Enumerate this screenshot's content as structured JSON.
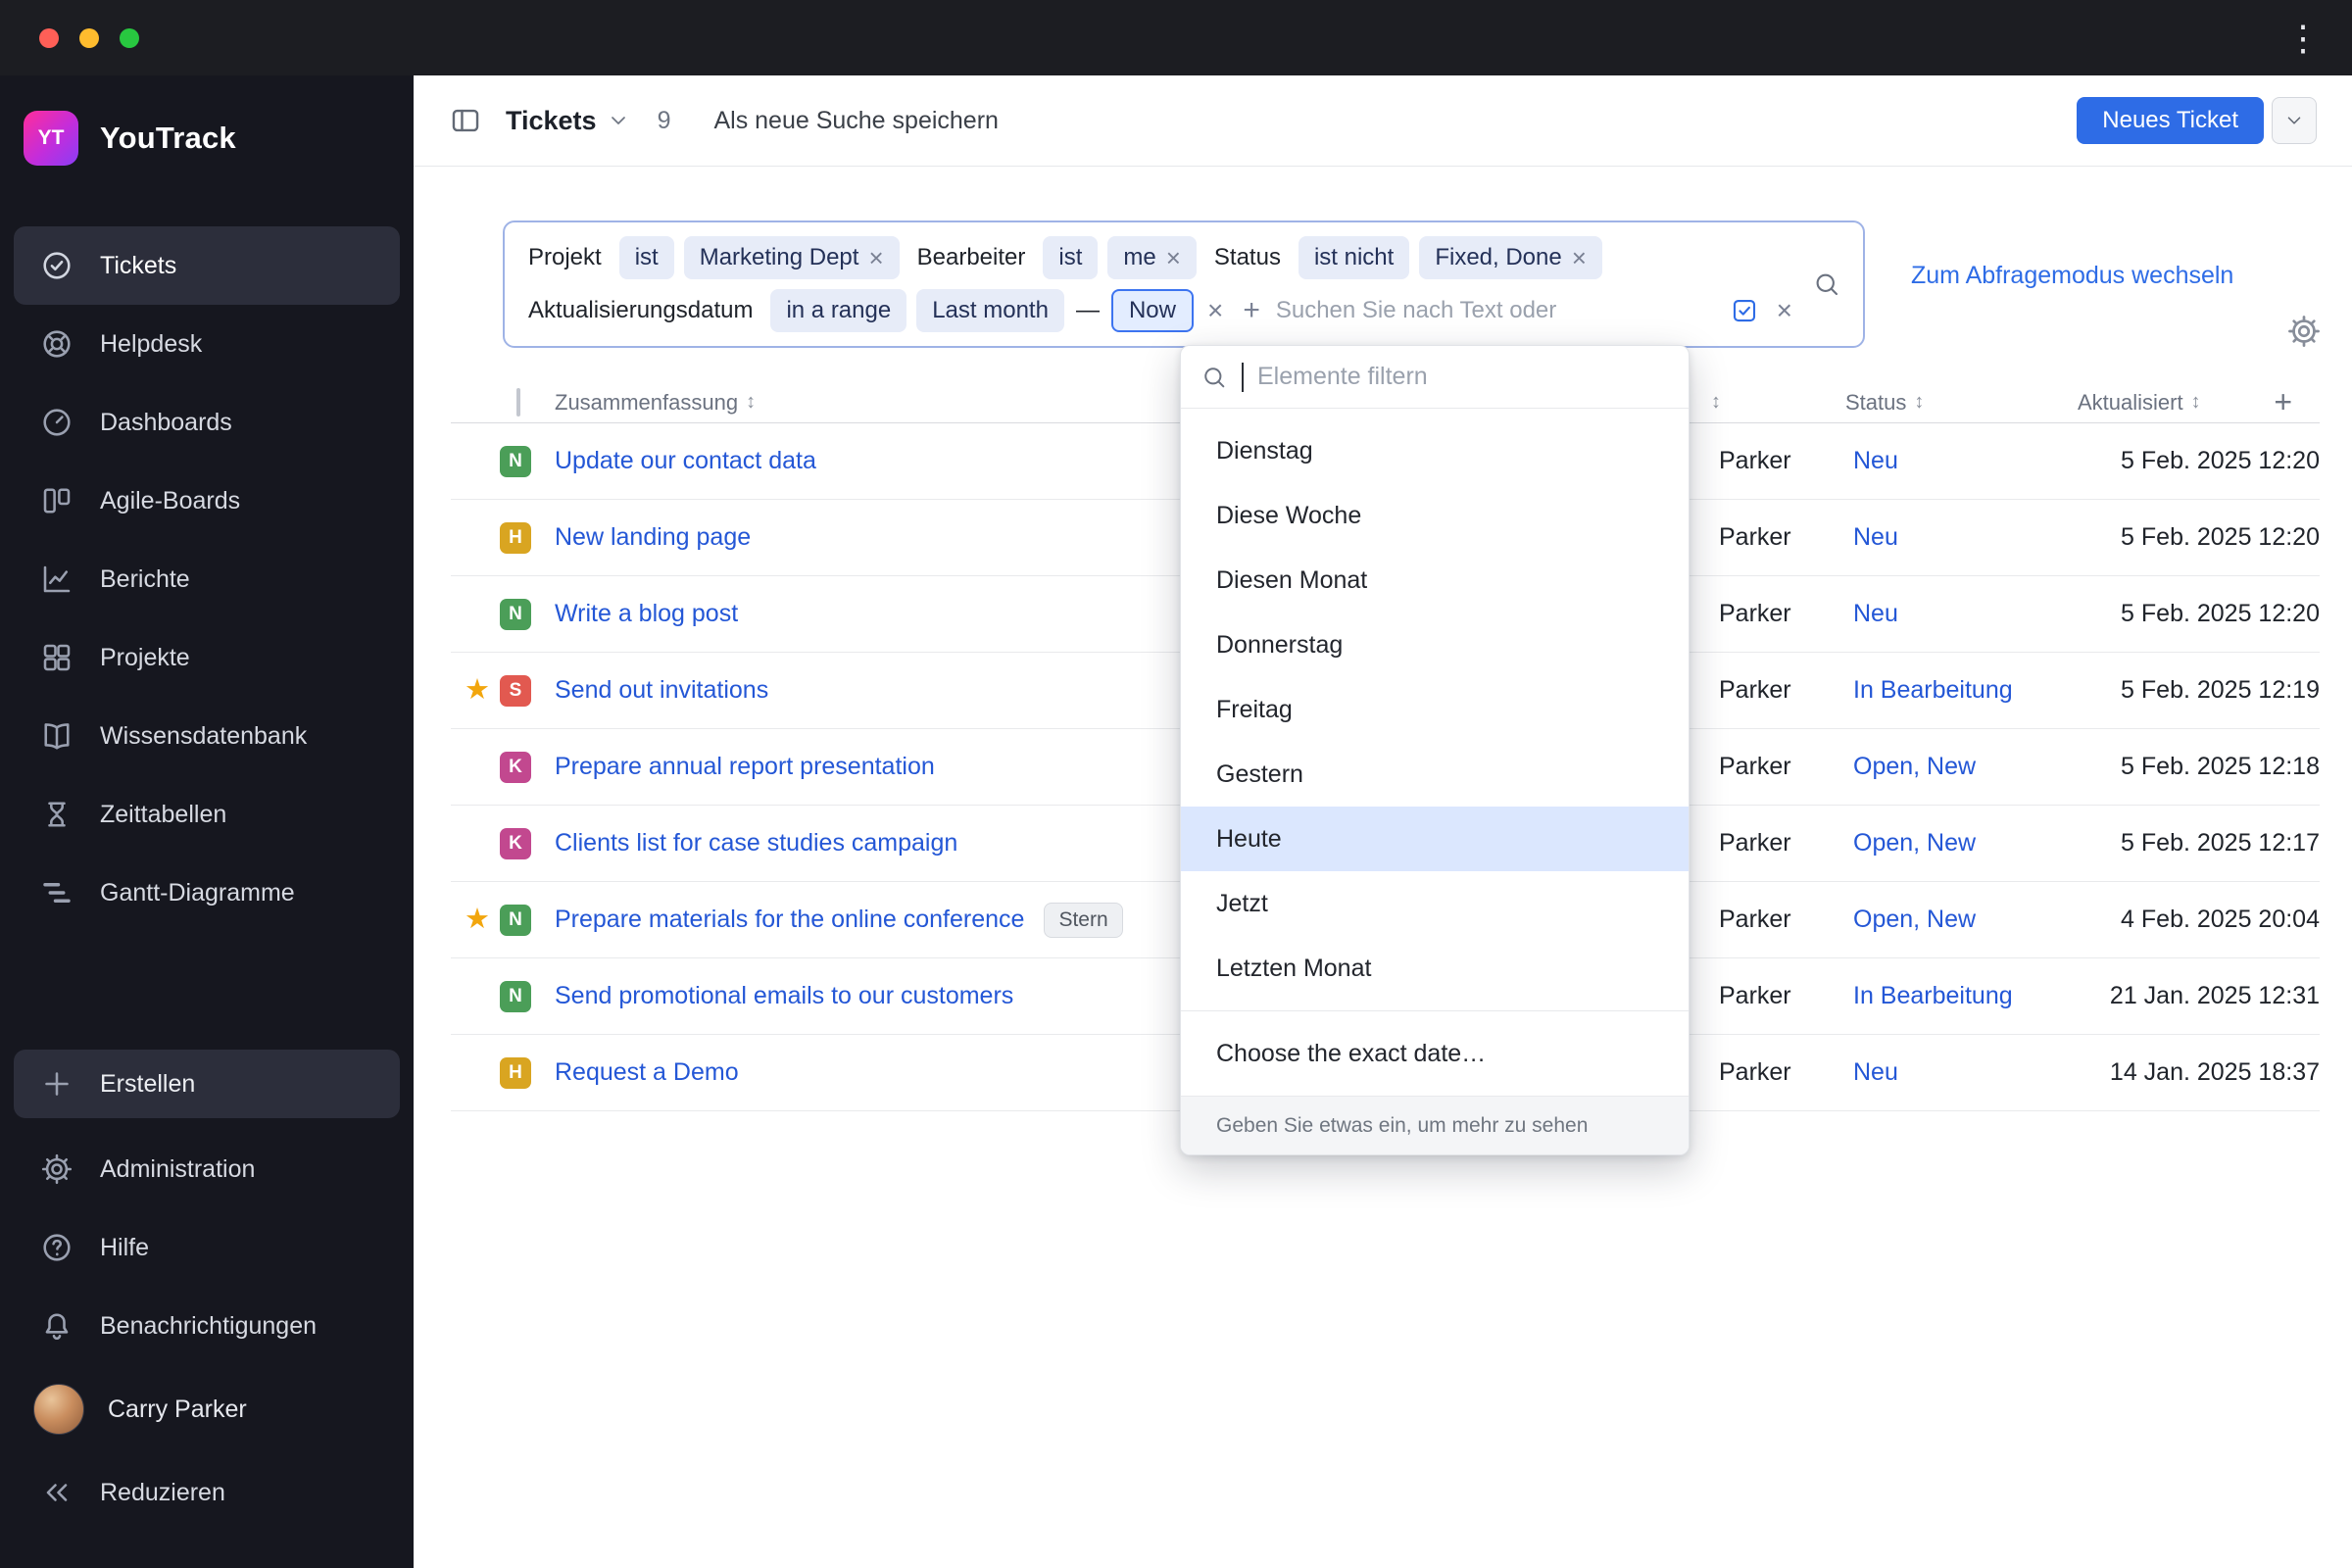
{
  "colors": {
    "accent_blue": "#2e6ce6",
    "link_blue": "#2457d6",
    "badge_green": "#4b9e58",
    "badge_amber": "#d9a521",
    "badge_red": "#e25950",
    "badge_magenta": "#c2488f",
    "star": "#f2a60d",
    "selected_item_bg": "#dbe7fe"
  },
  "sidebar": {
    "logo_badge": "YT",
    "logo_text": "YouTrack",
    "items": [
      {
        "label": "Tickets"
      },
      {
        "label": "Helpdesk"
      },
      {
        "label": "Dashboards"
      },
      {
        "label": "Agile-Boards"
      },
      {
        "label": "Berichte"
      },
      {
        "label": "Projekte"
      },
      {
        "label": "Wissensdatenbank"
      },
      {
        "label": "Zeittabellen"
      },
      {
        "label": "Gantt-Diagramme"
      }
    ],
    "create_label": "Erstellen",
    "admin_items": [
      "Administration",
      "Hilfe",
      "Benachrichtigungen"
    ],
    "user_name": "Carry Parker",
    "collapse_label": "Reduzieren"
  },
  "header": {
    "title": "Tickets",
    "count": "9",
    "save_search": "Als neue Suche speichern",
    "new_ticket": "Neues Ticket"
  },
  "filter": {
    "groups": [
      {
        "attr": "Projekt",
        "op": "ist",
        "value": "Marketing Dept"
      },
      {
        "attr": "Bearbeiter",
        "op": "ist",
        "value": "me"
      },
      {
        "attr": "Status",
        "op": "ist nicht",
        "value": "Fixed, Done"
      }
    ],
    "range": {
      "attr": "Aktualisierungsdatum",
      "op": "in a range",
      "from": "Last month",
      "dash": "—",
      "to": "Now"
    },
    "input_placeholder": "Suchen Sie nach Text oder",
    "mode_switch": "Zum Abfragemodus wechseln"
  },
  "table": {
    "headers": {
      "summary": "Zusammenfassung",
      "status": "Status",
      "updated": "Aktualisiert"
    },
    "rows": [
      {
        "badge": "N",
        "badge_color": "#4b9e58",
        "summary": "Update our contact data",
        "assignee": "Parker",
        "status": "Neu",
        "updated": "5 Feb. 2025 12:20"
      },
      {
        "badge": "H",
        "badge_color": "#d9a521",
        "summary": "New landing page",
        "assignee": "Parker",
        "status": "Neu",
        "updated": "5 Feb. 2025 12:20"
      },
      {
        "badge": "N",
        "badge_color": "#4b9e58",
        "summary": "Write a blog post",
        "assignee": "Parker",
        "status": "Neu",
        "updated": "5 Feb. 2025 12:20"
      },
      {
        "badge": "S",
        "badge_color": "#e25950",
        "summary": "Send out invitations",
        "assignee": "Parker",
        "status": "In Bearbeitung",
        "updated": "5 Feb. 2025 12:19"
      },
      {
        "badge": "K",
        "badge_color": "#c2488f",
        "summary": "Prepare annual report presentation",
        "assignee": "Parker",
        "status": "Open, New",
        "updated": "5 Feb. 2025 12:18"
      },
      {
        "badge": "K",
        "badge_color": "#c2488f",
        "summary": "Clients list for case studies campaign",
        "assignee": "Parker",
        "status": "Open, New",
        "updated": "5 Feb. 2025 12:17"
      },
      {
        "badge": "N",
        "badge_color": "#4b9e58",
        "summary": "Prepare materials for the online conference",
        "tag": "Stern",
        "assignee": "Parker",
        "status": "Open, New",
        "updated": "4 Feb. 2025 20:04"
      },
      {
        "badge": "N",
        "badge_color": "#4b9e58",
        "summary": "Send promotional emails to our customers",
        "assignee": "Parker",
        "status": "In Bearbeitung",
        "updated": "21 Jan. 2025 12:31"
      },
      {
        "badge": "H",
        "badge_color": "#d9a521",
        "summary": "Request a Demo",
        "assignee": "Parker",
        "status": "Neu",
        "updated": "14 Jan. 2025 18:37"
      }
    ]
  },
  "dropdown": {
    "search_placeholder": "Elemente filtern",
    "items": [
      "Dienstag",
      "Diese Woche",
      "Diesen Monat",
      "Donnerstag",
      "Freitag",
      "Gestern",
      "Heute",
      "Jetzt",
      "Letzten Monat"
    ],
    "selected_item": "Heute",
    "exact_date": "Choose the exact date…",
    "footer": "Geben Sie etwas ein, um mehr zu sehen"
  }
}
